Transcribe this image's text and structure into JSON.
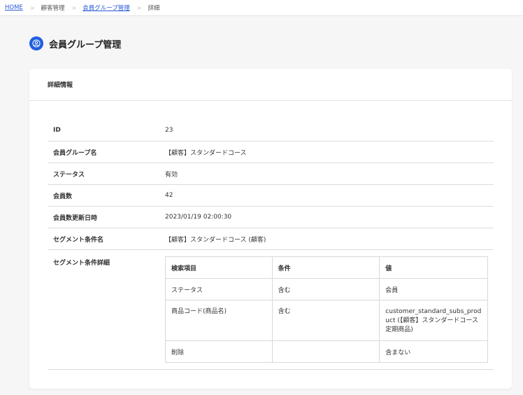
{
  "breadcrumb": {
    "home": "HOME",
    "customer": "顧客管理",
    "group": "会員グループ管理",
    "current": "詳細",
    "separator": ">"
  },
  "page": {
    "title": "会員グループ管理",
    "icon": "user-circle-icon",
    "accent_color": "#1f5ee0"
  },
  "card": {
    "header": "詳細情報"
  },
  "details": {
    "id": {
      "label": "ID",
      "value": "23"
    },
    "group_name": {
      "label": "会員グループ名",
      "value": "【顧客】スタンダードコース"
    },
    "status": {
      "label": "ステータス",
      "value": "有効"
    },
    "member_count": {
      "label": "会員数",
      "value": "42"
    },
    "updated_at": {
      "label": "会員数更新日時",
      "value": "2023/01/19 02:00:30"
    },
    "segment_name": {
      "label": "セグメント条件名",
      "value": "【顧客】スタンダードコース (顧客)"
    },
    "segment_detail": {
      "label": "セグメント条件詳細"
    }
  },
  "conditions": {
    "headers": [
      "検索項目",
      "条件",
      "値"
    ],
    "rows": [
      [
        "ステータス",
        "含む",
        "会員"
      ],
      [
        "商品コード(商品名)",
        "含む",
        "customer_standard_subs_product (【顧客】スタンダードコース定期商品)"
      ],
      [
        "削除",
        "",
        "含まない"
      ]
    ]
  }
}
